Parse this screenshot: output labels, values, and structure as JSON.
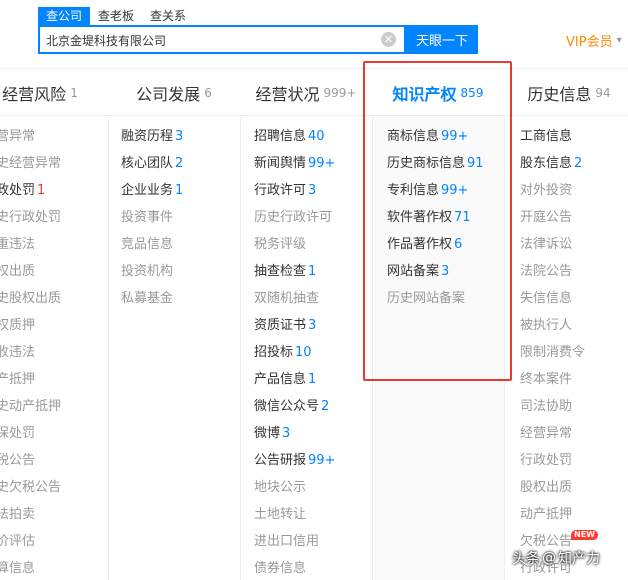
{
  "search": {
    "tabs": [
      {
        "label": "查公司",
        "active": true
      },
      {
        "label": "查老板",
        "active": false
      },
      {
        "label": "查关系",
        "active": false
      }
    ],
    "query": "北京金堤科技有限公司",
    "button_label": "天眼一下",
    "clear_icon": "close-icon"
  },
  "vip": {
    "label": "VIP会员",
    "caret": "chevron-down-icon"
  },
  "columns": [
    {
      "title": "经营风险",
      "count": "1",
      "items": [
        {
          "label": "营异常",
          "num": "",
          "active": false
        },
        {
          "label": "史经营异常",
          "num": "",
          "active": false
        },
        {
          "label": "政处罚",
          "num": "1",
          "active": true,
          "num_color": "red"
        },
        {
          "label": "史行政处罚",
          "num": "",
          "active": false
        },
        {
          "label": "重违法",
          "num": "",
          "active": false
        },
        {
          "label": "权出质",
          "num": "",
          "active": false
        },
        {
          "label": "史股权出质",
          "num": "",
          "active": false
        },
        {
          "label": "权质押",
          "num": "",
          "active": false
        },
        {
          "label": "收违法",
          "num": "",
          "active": false
        },
        {
          "label": "产抵押",
          "num": "",
          "active": false
        },
        {
          "label": "史动产抵押",
          "num": "",
          "active": false
        },
        {
          "label": "保处罚",
          "num": "",
          "active": false
        },
        {
          "label": "税公告",
          "num": "",
          "active": false
        },
        {
          "label": "史欠税公告",
          "num": "",
          "active": false
        },
        {
          "label": "法拍卖",
          "num": "",
          "active": false
        },
        {
          "label": "价评估",
          "num": "",
          "active": false
        },
        {
          "label": "算信息",
          "num": "",
          "active": false
        }
      ]
    },
    {
      "title": "公司发展",
      "count": "6",
      "items": [
        {
          "label": "融资历程",
          "num": "3",
          "active": true
        },
        {
          "label": "核心团队",
          "num": "2",
          "active": true
        },
        {
          "label": "企业业务",
          "num": "1",
          "active": true
        },
        {
          "label": "投资事件",
          "num": "",
          "active": false
        },
        {
          "label": "竞品信息",
          "num": "",
          "active": false
        },
        {
          "label": "投资机构",
          "num": "",
          "active": false
        },
        {
          "label": "私募基金",
          "num": "",
          "active": false
        }
      ]
    },
    {
      "title": "经营状况",
      "count": "999+",
      "items": [
        {
          "label": "招聘信息",
          "num": "40",
          "active": true
        },
        {
          "label": "新闻舆情",
          "num": "99+",
          "active": true
        },
        {
          "label": "行政许可",
          "num": "3",
          "active": true
        },
        {
          "label": "历史行政许可",
          "num": "",
          "active": false
        },
        {
          "label": "税务评级",
          "num": "",
          "active": false
        },
        {
          "label": "抽查检查",
          "num": "1",
          "active": true
        },
        {
          "label": "双随机抽查",
          "num": "",
          "active": false
        },
        {
          "label": "资质证书",
          "num": "3",
          "active": true
        },
        {
          "label": "招投标",
          "num": "10",
          "active": true
        },
        {
          "label": "产品信息",
          "num": "1",
          "active": true
        },
        {
          "label": "微信公众号",
          "num": "2",
          "active": true
        },
        {
          "label": "微博",
          "num": "3",
          "active": true
        },
        {
          "label": "公告研报",
          "num": "99+",
          "active": true
        },
        {
          "label": "地块公示",
          "num": "",
          "active": false
        },
        {
          "label": "土地转让",
          "num": "",
          "active": false
        },
        {
          "label": "进出口信用",
          "num": "",
          "active": false
        },
        {
          "label": "债券信息",
          "num": "",
          "active": false
        }
      ]
    },
    {
      "title": "知识产权",
      "count": "859",
      "items": [
        {
          "label": "商标信息",
          "num": "99+",
          "active": true
        },
        {
          "label": "历史商标信息",
          "num": "91",
          "active": true
        },
        {
          "label": "专利信息",
          "num": "99+",
          "active": true
        },
        {
          "label": "软件著作权",
          "num": "71",
          "active": true
        },
        {
          "label": "作品著作权",
          "num": "6",
          "active": true
        },
        {
          "label": "网站备案",
          "num": "3",
          "active": true
        },
        {
          "label": "历史网站备案",
          "num": "",
          "active": false
        }
      ]
    },
    {
      "title": "历史信息",
      "count": "94",
      "items": [
        {
          "label": "工商信息",
          "num": "",
          "active": true
        },
        {
          "label": "股东信息",
          "num": "2",
          "active": true
        },
        {
          "label": "对外投资",
          "num": "",
          "active": false
        },
        {
          "label": "开庭公告",
          "num": "",
          "active": false
        },
        {
          "label": "法律诉讼",
          "num": "",
          "active": false
        },
        {
          "label": "法院公告",
          "num": "",
          "active": false
        },
        {
          "label": "失信信息",
          "num": "",
          "active": false
        },
        {
          "label": "被执行人",
          "num": "",
          "active": false
        },
        {
          "label": "限制消费令",
          "num": "",
          "active": false
        },
        {
          "label": "终本案件",
          "num": "",
          "active": false
        },
        {
          "label": "司法协助",
          "num": "",
          "active": false
        },
        {
          "label": "经营异常",
          "num": "",
          "active": false
        },
        {
          "label": "行政处罚",
          "num": "",
          "active": false
        },
        {
          "label": "股权出质",
          "num": "",
          "active": false
        },
        {
          "label": "动产抵押",
          "num": "",
          "active": false
        },
        {
          "label": "欠税公告",
          "num": "",
          "active": false
        },
        {
          "label": "行政许可",
          "num": "",
          "active": false
        }
      ]
    }
  ],
  "new_badge": "NEW",
  "watermark": {
    "prefix": "头条",
    "at": "@",
    "name": "知产力"
  },
  "colors": {
    "brand": "#0084ff",
    "vip": "#ff8a00",
    "highlight": "#e53935",
    "muted": "#999999"
  }
}
